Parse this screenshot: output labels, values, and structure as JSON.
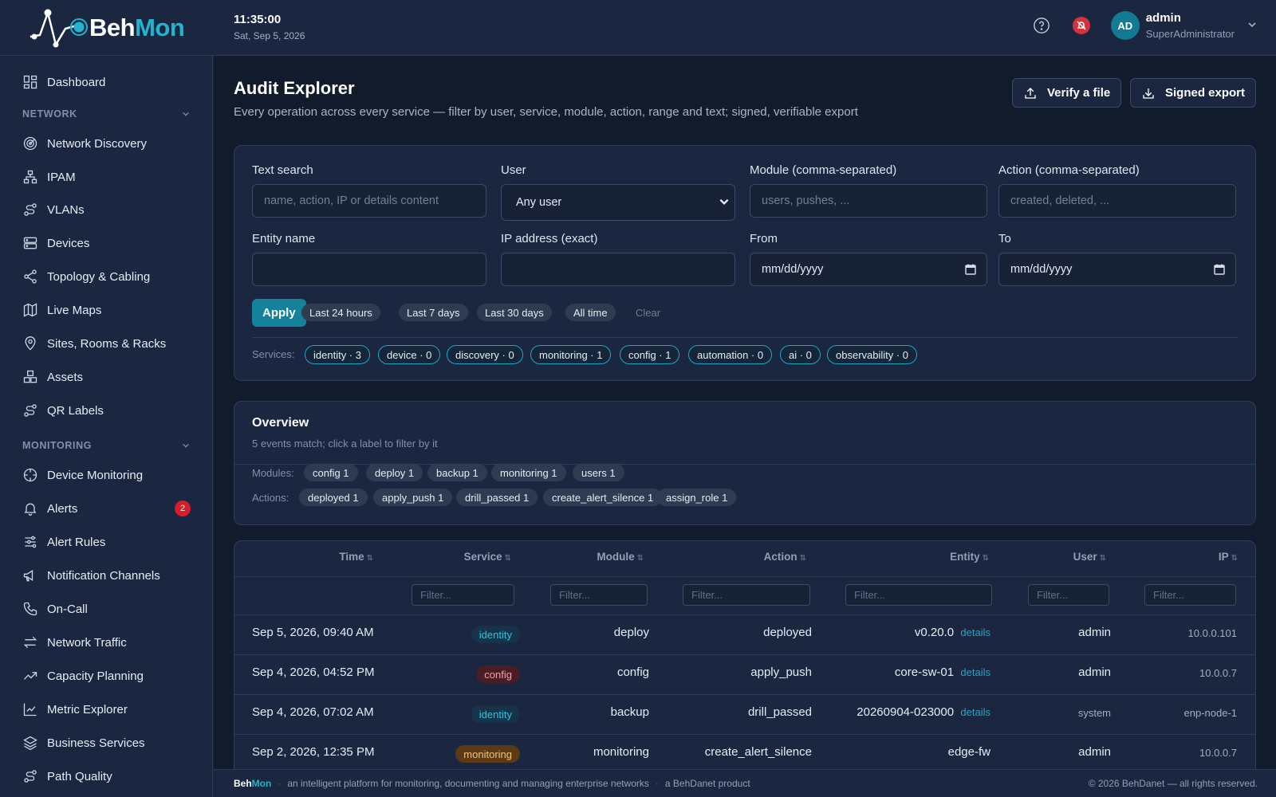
{
  "brand": {
    "part1": "Beh",
    "part2": "Mon"
  },
  "clock": {
    "time": "11:35:00",
    "date": "Sat, Sep 5, 2026"
  },
  "user": {
    "initials": "AD",
    "name": "admin",
    "role": "SuperAdministrator"
  },
  "sidebar": {
    "dashboard": "Dashboard",
    "network_section": "NETWORK",
    "network_items": [
      "Network Discovery",
      "IPAM",
      "VLANs",
      "Devices",
      "Topology & Cabling",
      "Live Maps",
      "Sites, Rooms & Racks",
      "Assets",
      "QR Labels"
    ],
    "monitoring_section": "MONITORING",
    "monitoring_items": [
      "Device Monitoring",
      "Alerts",
      "Alert Rules",
      "Notification Channels",
      "On-Call",
      "Network Traffic",
      "Capacity Planning",
      "Metric Explorer",
      "Business Services",
      "Path Quality"
    ],
    "alerts_badge": "2"
  },
  "page": {
    "title": "Audit Explorer",
    "subtitle": "Every operation across every service — filter by user, service, module, action, range and text; signed, verifiable export",
    "verify_label": "Verify a file",
    "export_label": "Signed export"
  },
  "filters": {
    "text_search_label": "Text search",
    "text_search_placeholder": "name, action, IP or details content",
    "user_label": "User",
    "user_value": "Any user",
    "module_label": "Module (comma-separated)",
    "module_placeholder": "users, pushes, ...",
    "action_label": "Action (comma-separated)",
    "action_placeholder": "created, deleted, ...",
    "entity_label": "Entity name",
    "ip_label": "IP address (exact)",
    "from_label": "From",
    "from_value": "mm/dd/yyyy",
    "to_label": "To",
    "to_value": "mm/dd/yyyy",
    "apply": "Apply",
    "ranges": [
      "Last 24 hours",
      "Last 7 days",
      "Last 30 days",
      "All time"
    ],
    "clear": "Clear",
    "services_label": "Services:",
    "services": [
      "identity · 3",
      "device · 0",
      "discovery · 0",
      "monitoring · 1",
      "config · 1",
      "automation · 0",
      "ai · 0",
      "observability · 0"
    ]
  },
  "overview": {
    "title": "Overview",
    "subtitle": "5 events match; click a label to filter by it",
    "modules_label": "Modules:",
    "modules": [
      "config 1",
      "deploy 1",
      "backup 1",
      "monitoring 1",
      "users 1"
    ],
    "actions_label": "Actions:",
    "actions": [
      "deployed 1",
      "apply_push 1",
      "drill_passed 1",
      "create_alert_silence 1",
      "assign_role 1"
    ]
  },
  "table": {
    "columns": [
      "Time",
      "Service",
      "Module",
      "Action",
      "Entity",
      "User",
      "IP"
    ],
    "filter_placeholder": "Filter...",
    "details_label": "details",
    "rows": [
      {
        "time": "Sep 5, 2026, 09:40 AM",
        "service": "identity",
        "module": "deploy",
        "action": "deployed",
        "entity": "v0.20.0",
        "user": "admin",
        "ip": "10.0.0.101"
      },
      {
        "time": "Sep 4, 2026, 04:52 PM",
        "service": "config",
        "module": "config",
        "action": "apply_push",
        "entity": "core-sw-01",
        "user": "admin",
        "ip": "10.0.0.7"
      },
      {
        "time": "Sep 4, 2026, 07:02 AM",
        "service": "identity",
        "module": "backup",
        "action": "drill_passed",
        "entity": "20260904-023000",
        "user": "system",
        "ip": "enp-node-1"
      },
      {
        "time": "Sep 2, 2026, 12:35 PM",
        "service": "monitoring",
        "module": "monitoring",
        "action": "create_alert_silence",
        "entity": "edge-fw",
        "user": "admin",
        "ip": "10.0.0.7"
      }
    ]
  },
  "footer": {
    "brand1": "Beh",
    "brand2": "Mon",
    "tagline": "an intelligent platform for monitoring, documenting and managing enterprise networks",
    "product": "a BehDanet product",
    "copyright": "© 2026 BehDanet — all rights reserved."
  }
}
